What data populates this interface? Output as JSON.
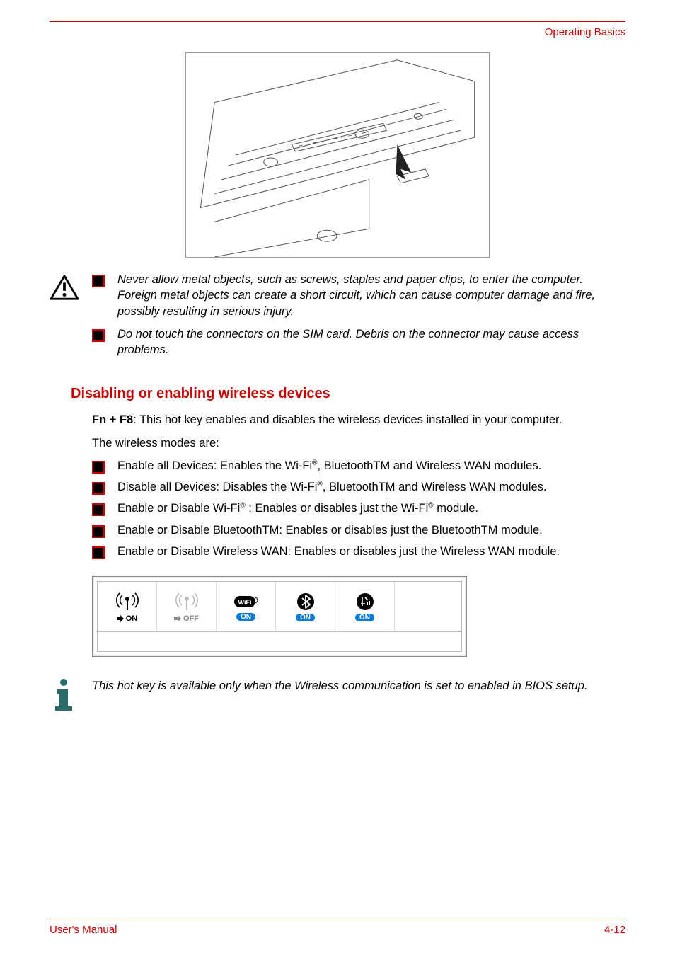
{
  "header": {
    "section": "Operating Basics"
  },
  "warning": {
    "items": [
      "Never allow metal objects, such as screws, staples and paper clips, to enter the computer. Foreign metal objects can create a short circuit, which can cause computer damage and fire, possibly resulting in serious injury.",
      "Do not touch the connectors on the SIM card. Debris on the connector may cause access problems."
    ]
  },
  "section": {
    "heading": "Disabling or enabling wireless devices",
    "intro_bold": "Fn + F8",
    "intro_rest": ": This hot key enables and disables the wireless devices installed in your computer.",
    "modes_label": "The wireless modes are:",
    "modes": [
      {
        "pre": "Enable all Devices: Enables the Wi-Fi",
        "sup": "®",
        "post": ", BluetoothTM and Wireless WAN modules."
      },
      {
        "pre": "Disable all Devices: Disables the Wi-Fi",
        "sup": "®",
        "post": ", BluetoothTM and Wireless WAN modules."
      },
      {
        "pre": "Enable or Disable Wi-Fi",
        "sup": "®",
        "mid": " : Enables or disables just the Wi-Fi",
        "sup2": "®",
        "post": " module."
      },
      {
        "pre": "Enable or Disable BluetoothTM: Enables or disables just the BluetoothTM module.",
        "sup": "",
        "post": ""
      },
      {
        "pre": "Enable or Disable Wireless WAN: Enables or disables just the Wireless WAN module.",
        "sup": "",
        "post": ""
      }
    ]
  },
  "osd": {
    "on_label": "ON",
    "off_label": "OFF",
    "badge": "ON"
  },
  "note": {
    "text": "This hot key is available only when the Wireless communication is set to enabled in BIOS setup."
  },
  "footer": {
    "left": "User's Manual",
    "right": "4-12"
  }
}
